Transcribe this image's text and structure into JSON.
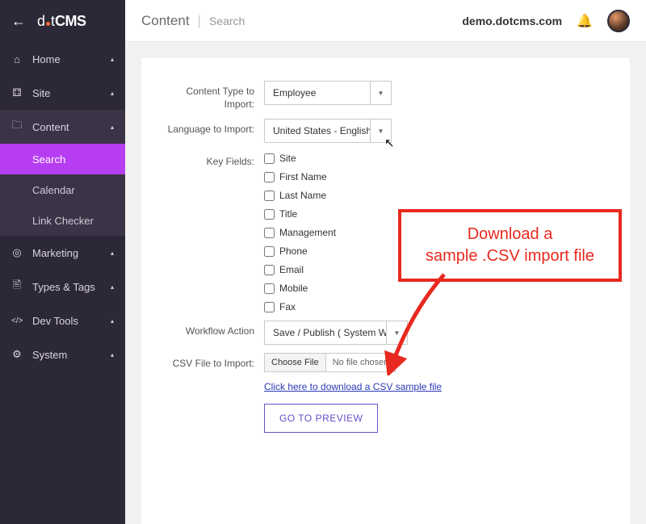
{
  "brand": {
    "part1": "d",
    "part2": "t",
    "part3": "CMS"
  },
  "header": {
    "crumb_main": "Content",
    "crumb_sub": "Search",
    "domain": "demo.dotcms.com"
  },
  "sidebar": {
    "items": [
      {
        "icon": "⌂",
        "label": "Home"
      },
      {
        "icon": "⚃",
        "label": "Site"
      },
      {
        "icon": "🗀",
        "label": "Content",
        "open": true,
        "children": [
          {
            "label": "Search",
            "active": true
          },
          {
            "label": "Calendar"
          },
          {
            "label": "Link Checker"
          }
        ]
      },
      {
        "icon": "◎",
        "label": "Marketing"
      },
      {
        "icon": "🖹",
        "label": "Types & Tags"
      },
      {
        "icon": "</>",
        "label": "Dev Tools"
      },
      {
        "icon": "⚙",
        "label": "System"
      }
    ]
  },
  "form": {
    "content_type_label": "Content Type to Import:",
    "content_type_value": "Employee",
    "language_label": "Language to Import:",
    "language_value": "United States - English",
    "key_fields_label": "Key Fields:",
    "key_fields": [
      "Site",
      "First Name",
      "Last Name",
      "Title",
      "Management",
      "Phone",
      "Email",
      "Mobile",
      "Fax"
    ],
    "workflow_label": "Workflow Action",
    "workflow_value": "Save / Publish ( System W",
    "csv_label": "CSV File to Import:",
    "choose_file": "Choose File",
    "no_file": "No file chosen",
    "sample_link": "Click here to download a CSV sample file",
    "preview_btn": "GO TO PREVIEW"
  },
  "annotation": {
    "line1": "Download a",
    "line2": "sample .CSV import file"
  }
}
